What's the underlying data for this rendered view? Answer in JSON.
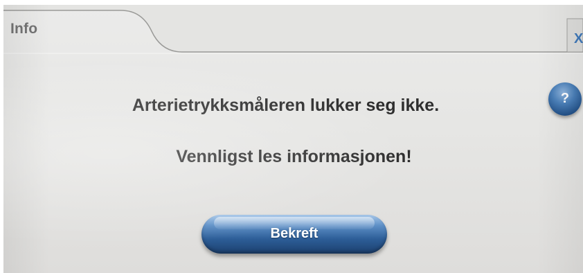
{
  "dialog": {
    "title": "Info",
    "close_label": "X",
    "message_line_1": "Arterietrykksmåleren lukker seg ikke.",
    "message_line_2": "Vennligst les informasjonen!",
    "help_label": "?",
    "confirm_label": "Bekreft"
  },
  "colors": {
    "panel_background": "#e6e6e4",
    "tab_text": "#747474",
    "message_text": "#2e2e2e",
    "button_blue": "#2d5e98",
    "button_text": "#ffffff"
  },
  "icons": {
    "help": "question-mark-icon",
    "close": "close-icon"
  }
}
